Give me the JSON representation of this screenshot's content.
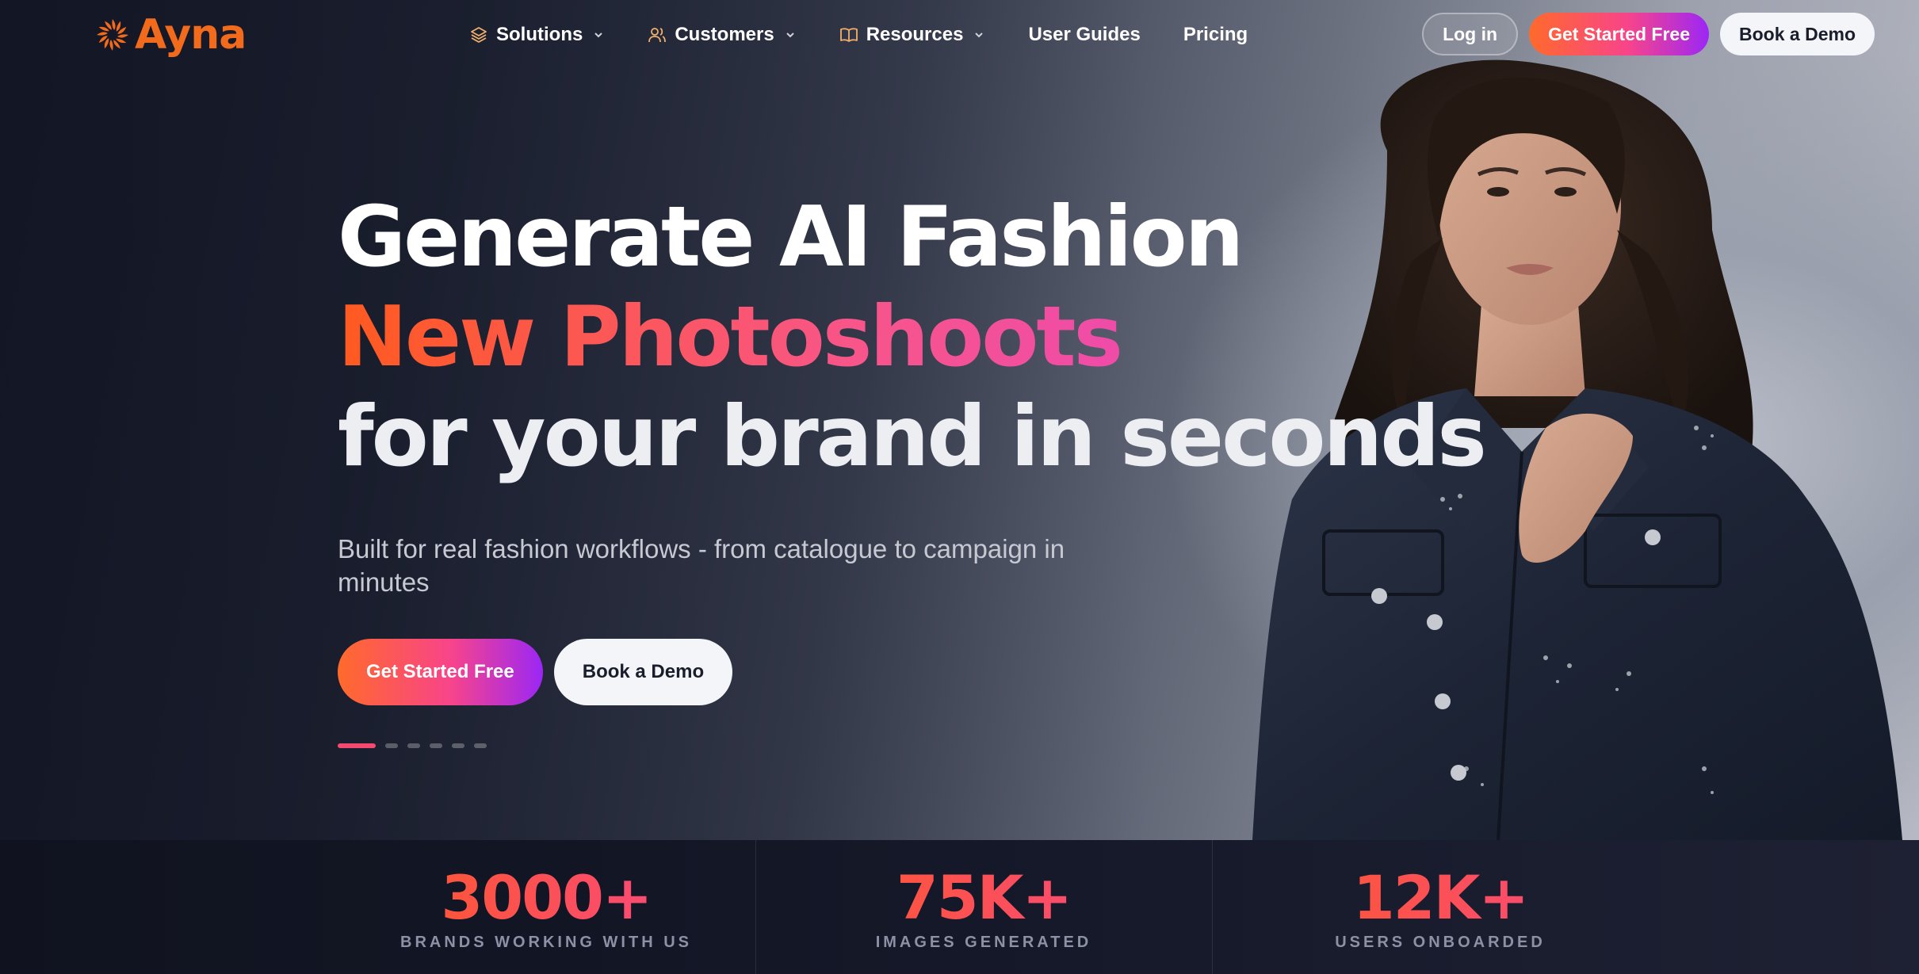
{
  "brand": {
    "name": "Ayna",
    "accent": "#f26a1b"
  },
  "nav": {
    "menu": [
      {
        "label": "Solutions",
        "icon": "layers-icon",
        "has_dropdown": true
      },
      {
        "label": "Customers",
        "icon": "users-icon",
        "has_dropdown": true
      },
      {
        "label": "Resources",
        "icon": "book-icon",
        "has_dropdown": true
      },
      {
        "label": "User Guides",
        "has_dropdown": false
      },
      {
        "label": "Pricing",
        "has_dropdown": false
      }
    ],
    "login": "Log in",
    "get_started": "Get Started Free",
    "book_demo": "Book a Demo"
  },
  "hero": {
    "line1": "Generate AI Fashion",
    "line2": "New Photoshoots",
    "line3": "for your brand in seconds",
    "subtitle": "Built for real fashion workflows - from catalogue to campaign in minutes",
    "cta_primary": "Get Started Free",
    "cta_secondary": "Book a Demo",
    "carousel": {
      "slides": 6,
      "active": 0
    }
  },
  "stats": [
    {
      "value": "3000+",
      "label": "BRANDS WORKING WITH US"
    },
    {
      "value": "75K+",
      "label": "IMAGES GENERATED"
    },
    {
      "value": "12K+",
      "label": "USERS ONBOARDED"
    }
  ],
  "colors": {
    "gradient_start": "#ff6a2b",
    "gradient_mid": "#f8448a",
    "gradient_end": "#9b27f5",
    "background": "#1b1f2e"
  }
}
